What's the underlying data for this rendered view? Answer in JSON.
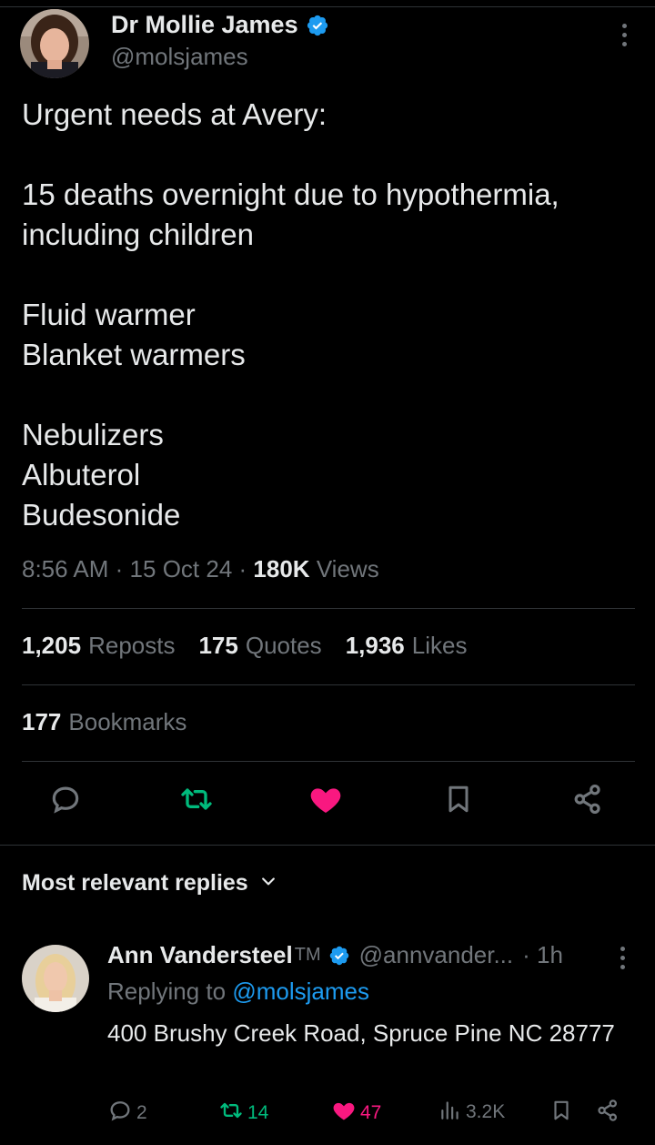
{
  "tweet": {
    "author_name": "Dr Mollie James",
    "author_handle": "@molsjames",
    "text": "Urgent needs at Avery:\n\n15 deaths overnight due to hypothermia, including children\n\nFluid warmer\nBlanket warmers\n\nNebulizers\nAlbuterol\nBudesonide",
    "time": "8:56 AM",
    "date": "15 Oct 24",
    "views_count": "180K",
    "views_label": "Views",
    "dot": "·"
  },
  "stats": {
    "reposts_count": "1,205",
    "reposts_label": "Reposts",
    "quotes_count": "175",
    "quotes_label": "Quotes",
    "likes_count": "1,936",
    "likes_label": "Likes",
    "bookmarks_count": "177",
    "bookmarks_label": "Bookmarks"
  },
  "icons": {
    "reply": "reply-icon",
    "repost": "repost-icon",
    "like": "heart-icon",
    "bookmark": "bookmark-icon",
    "share": "share-icon",
    "more": "more-icon",
    "verified": "verified-badge-icon",
    "views": "views-icon",
    "chevron": "chevron-down-icon"
  },
  "colors": {
    "background": "#000000",
    "text": "#e7e9ea",
    "muted": "#71767b",
    "link": "#1d9bf0",
    "repost_active": "#00ba7c",
    "like_active": "#f91880",
    "divider": "#2f3336"
  },
  "replies_section": {
    "label": "Most relevant replies"
  },
  "reply": {
    "author_name": "Ann Vandersteel",
    "tm": "TM",
    "author_handle": "@annvander...",
    "time": "· 1h",
    "replying_prefix": "Replying to",
    "replying_handle": "@molsjames",
    "text": "400 Brushy Creek Road, Spruce Pine NC 28777",
    "replies_count": "2",
    "reposts_count": "14",
    "likes_count": "47",
    "views_count": "3.2K"
  }
}
